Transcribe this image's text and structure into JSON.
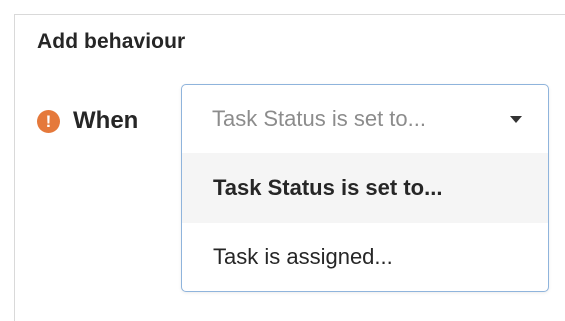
{
  "panel": {
    "title": "Add behaviour"
  },
  "rule": {
    "warning_icon": "exclamation-circle-icon",
    "label": "When",
    "warning_color": "#e5793b"
  },
  "trigger_select": {
    "placeholder": "Task Status is set to...",
    "options": [
      {
        "label": "Task Status is set to...",
        "highlighted": true
      },
      {
        "label": "Task is assigned...",
        "highlighted": false
      }
    ],
    "border_color": "#8fb4dc"
  }
}
